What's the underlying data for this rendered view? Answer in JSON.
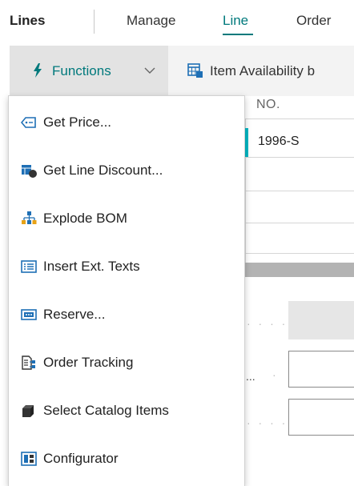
{
  "tabs": {
    "page_title": "Lines",
    "manage": "Manage",
    "line": "Line",
    "order": "Order"
  },
  "toolbar": {
    "functions_label": "Functions",
    "functions_icon": "lightning-icon",
    "item_availability_label": "Item Availability b",
    "item_availability_icon": "calendar-grid-icon"
  },
  "grid": {
    "column_header": "NO.",
    "first_row_no": "1996-S",
    "ellipsis": "..."
  },
  "menu": {
    "items": [
      {
        "label": "Get Price...",
        "icon": "price-tag-icon"
      },
      {
        "label": "Get Line Discount...",
        "icon": "discount-icon"
      },
      {
        "label": "Explode BOM",
        "icon": "bom-tree-icon"
      },
      {
        "label": "Insert Ext. Texts",
        "icon": "text-lines-icon"
      },
      {
        "label": "Reserve...",
        "icon": "reserve-icon"
      },
      {
        "label": "Order Tracking",
        "icon": "order-tracking-icon"
      },
      {
        "label": "Select Catalog Items",
        "icon": "catalog-icon"
      },
      {
        "label": "Configurator",
        "icon": "configurator-icon"
      }
    ]
  },
  "colors": {
    "accent": "#00797c",
    "selected_row": "#00b7c3",
    "icon_blue": "#1e6fb5"
  }
}
